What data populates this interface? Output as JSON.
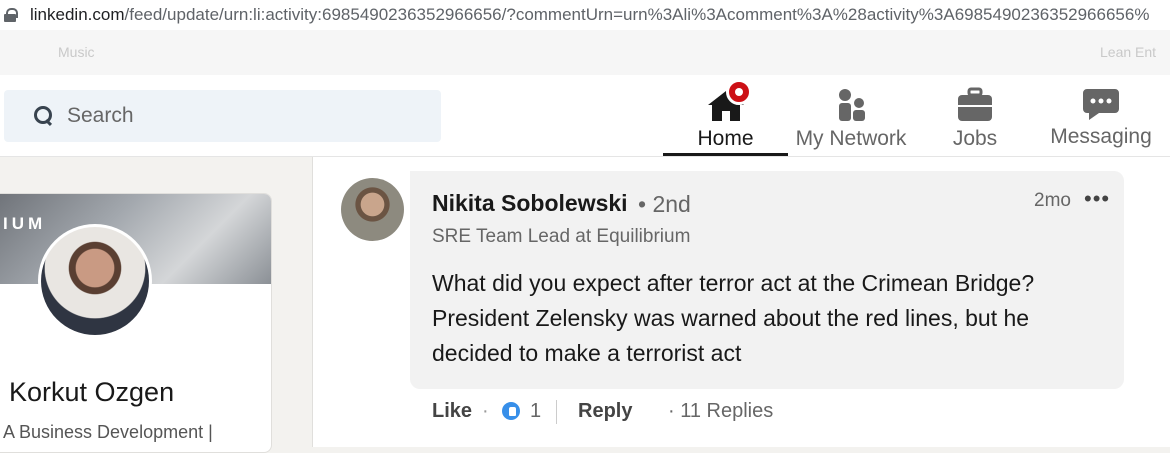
{
  "browser": {
    "url_host": "linkedin.com",
    "url_rest": "/feed/update/urn:li:activity:6985490236352966656/?commentUrn=urn%3Ali%3Acomment%3A%28activity%3A6985490236352966656%"
  },
  "bookmarks": {
    "items": [
      "Music",
      "Lean Ent"
    ]
  },
  "nav": {
    "search_placeholder": "Search",
    "items": [
      {
        "label": "Home",
        "active": true
      },
      {
        "label": "My Network"
      },
      {
        "label": "Jobs"
      },
      {
        "label": "Messaging"
      }
    ]
  },
  "profile": {
    "cover_text": "IUM",
    "name": "Korkut Ozgen",
    "subtitle": "A Business Development |"
  },
  "comment": {
    "author": "Nikita Sobolewski",
    "degree": "• 2nd",
    "time": "2mo",
    "more": "•••",
    "headline": "SRE Team Lead at Equilibrium",
    "text": "What did you expect after terror act at the Crimean Bridge? President Zelensky was warned about the red lines, but he decided to make a terrorist act",
    "like_label": "Like",
    "like_dot": "·",
    "like_count": "1",
    "reply_label": "Reply",
    "replies_text": "· 11 Replies"
  },
  "colors": {
    "accent_blue": "#378fe9",
    "notification_red": "#cc1016",
    "bubble_bg": "#f2f2f2"
  }
}
